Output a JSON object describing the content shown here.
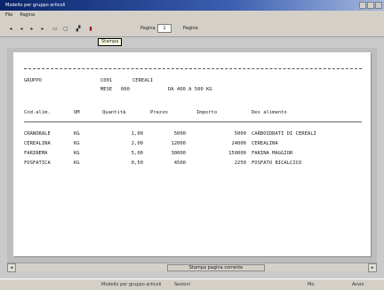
{
  "window": {
    "title": "Modello per gruppo articoli"
  },
  "menu": {
    "file": "File",
    "pagina": "Pagina"
  },
  "toolbar": {
    "page_label": "Pagina",
    "page_value": "1",
    "pages_label": "Pagine",
    "tooltip": "Stampa"
  },
  "report": {
    "gruppo_label": "GRUPPO",
    "gruppo_code": "C001",
    "gruppo_name": "CEREALI",
    "mese_label": "MESE",
    "mese_value": "000",
    "range_text": "DA 400 A 500 KG",
    "headers": [
      "Cod.alim.",
      "UM",
      "Quantità",
      "Prezzo",
      "Importo",
      "Des alimento"
    ],
    "rows": [
      {
        "code": "CRANORALE",
        "um": "KG",
        "qty": "1,00",
        "price": "5000",
        "amount": "5000",
        "desc": "CARBOIDRATI DI CEREALI"
      },
      {
        "code": "CEREALINA",
        "um": "KG",
        "qty": "2,00",
        "price": "12000",
        "amount": "24000",
        "desc": "CEREALINA"
      },
      {
        "code": "FARINEMA",
        "um": "KG",
        "qty": "5,00",
        "price": "30000",
        "amount": "150000",
        "desc": "FARINA MAGGIOR"
      },
      {
        "code": "FOSFATICA",
        "um": "KG",
        "qty": "0,50",
        "price": "4500",
        "amount": "2250",
        "desc": "FOSFATO BICALCICO"
      }
    ]
  },
  "status": {
    "text": "Stampa pagina corrente"
  },
  "taskbar": {
    "item1": "Modello per gruppo articoli",
    "item2": "Sezioni",
    "item3": "Mo",
    "item4": "Avvio"
  },
  "colors": {
    "titlebar_start": "#0a246a",
    "paper": "#ffffff",
    "canvas": "#bdbdbd"
  }
}
